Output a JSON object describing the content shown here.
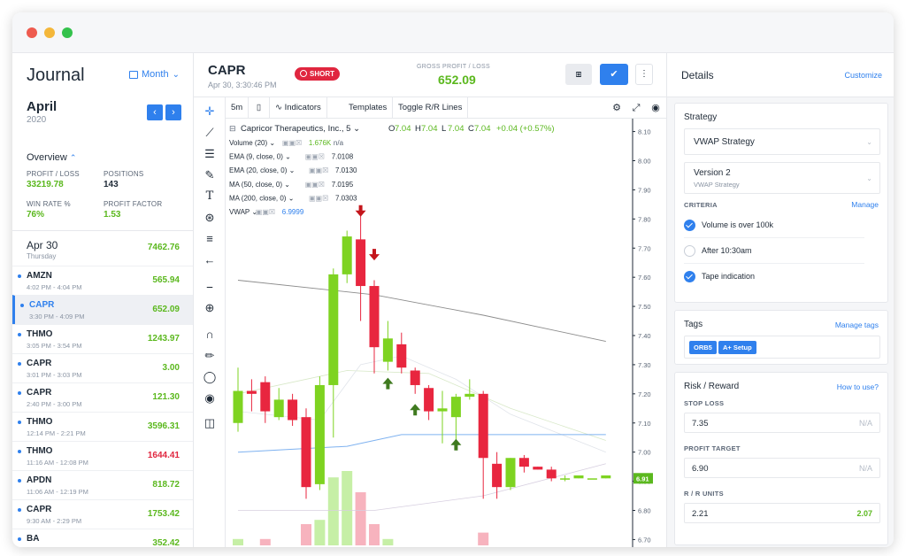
{
  "colors": {
    "accent": "#2f80ed",
    "green": "#5bb81e",
    "red": "#e0263f",
    "candle_up": "#7ed321",
    "candle_down": "#e8263f"
  },
  "journal": {
    "title": "Journal",
    "view_select": "Month",
    "month": "April",
    "year": "2020",
    "overview_label": "Overview",
    "stats": {
      "profit_loss_label": "PROFIT / LOSS",
      "profit_loss_value": "33219.78",
      "positions_label": "POSITIONS",
      "positions_value": "143",
      "win_rate_label": "WIN RATE %",
      "win_rate_value": "76%",
      "profit_factor_label": "PROFIT FACTOR",
      "profit_factor_value": "1.53"
    },
    "day": {
      "date": "Apr 30",
      "weekday": "Thursday",
      "total": "7462.76"
    },
    "trades": [
      {
        "symbol": "AMZN",
        "time": "4:02 PM - 4:04 PM",
        "value": "565.94",
        "color": "green",
        "active": false
      },
      {
        "symbol": "CAPR",
        "time": "3:30 PM - 4:09 PM",
        "value": "652.09",
        "color": "green",
        "active": true
      },
      {
        "symbol": "THMO",
        "time": "3:05 PM - 3:54 PM",
        "value": "1243.97",
        "color": "green",
        "active": false
      },
      {
        "symbol": "CAPR",
        "time": "3:01 PM - 3:03 PM",
        "value": "3.00",
        "color": "green",
        "active": false
      },
      {
        "symbol": "CAPR",
        "time": "2:40 PM - 3:00 PM",
        "value": "121.30",
        "color": "green",
        "active": false
      },
      {
        "symbol": "THMO",
        "time": "12:14 PM - 2:21 PM",
        "value": "3596.31",
        "color": "green",
        "active": false
      },
      {
        "symbol": "THMO",
        "time": "11:16 AM - 12:08 PM",
        "value": "1644.41",
        "color": "red",
        "active": false
      },
      {
        "symbol": "APDN",
        "time": "11:06 AM - 12:19 PM",
        "value": "818.72",
        "color": "green",
        "active": false
      },
      {
        "symbol": "CAPR",
        "time": "9:30 AM - 2:29 PM",
        "value": "1753.42",
        "color": "green",
        "active": false
      },
      {
        "symbol": "BA",
        "time": "",
        "value": "352.42",
        "color": "green",
        "active": false
      }
    ]
  },
  "center": {
    "symbol": "CAPR",
    "datetime": "Apr 30, 3:30:46 PM",
    "side_badge": "SHORT",
    "gross_label": "GROSS PROFIT / LOSS",
    "gross_value": "652.09",
    "toolbar": {
      "interval": "5m",
      "indicators": "Indicators",
      "templates": "Templates",
      "toggle": "Toggle R/R Lines"
    },
    "legend": {
      "instrument": "Capricor Therapeutics, Inc., 5",
      "open_label": "O",
      "open": "7.04",
      "high_label": "H",
      "high": "7.04",
      "low_label": "L",
      "low": "7.04",
      "close_label": "C",
      "close": "7.04",
      "change": "+0.04 (+0.57%)",
      "studies": [
        {
          "name": "Volume (20)",
          "value": "1.676K",
          "extra": "n/a",
          "color": "#5bb81e"
        },
        {
          "name": "EMA (9, close, 0)",
          "value": "7.0108",
          "extra": "",
          "color": "#1f2a37"
        },
        {
          "name": "EMA (20, close, 0)",
          "value": "7.0130",
          "extra": "",
          "color": "#1f2a37"
        },
        {
          "name": "MA (50, close, 0)",
          "value": "7.0195",
          "extra": "",
          "color": "#1f2a37"
        },
        {
          "name": "MA (200, close, 0)",
          "value": "7.0303",
          "extra": "",
          "color": "#1f2a37"
        },
        {
          "name": "VWAP",
          "value": "6.9999",
          "extra": "",
          "color": "#2f80ed"
        }
      ]
    },
    "price_tag": "6.91"
  },
  "chart_data": {
    "type": "candlestick",
    "y_ticks": [
      "8.10",
      "8.00",
      "7.90",
      "7.80",
      "7.70",
      "7.60",
      "7.50",
      "7.40",
      "7.30",
      "7.20",
      "7.10",
      "7.00",
      "6.90",
      "6.80",
      "6.70"
    ],
    "ylim": [
      6.68,
      8.12
    ],
    "candles": [
      {
        "o": 7.1,
        "c": 7.21,
        "h": 7.29,
        "l": 7.07,
        "v": 0.3
      },
      {
        "o": 7.21,
        "c": 7.2,
        "h": 7.25,
        "l": 7.14,
        "v": 0.0
      },
      {
        "o": 7.24,
        "c": 7.14,
        "h": 7.26,
        "l": 7.1,
        "v": 0.3
      },
      {
        "o": 7.12,
        "c": 7.18,
        "h": 7.22,
        "l": 7.11,
        "v": 0.0
      },
      {
        "o": 7.18,
        "c": 7.11,
        "h": 7.2,
        "l": 7.09,
        "v": 0.0
      },
      {
        "o": 7.12,
        "c": 6.88,
        "h": 7.15,
        "l": 6.84,
        "v": 1.0
      },
      {
        "o": 6.89,
        "c": 7.23,
        "h": 7.26,
        "l": 6.87,
        "v": 1.2
      },
      {
        "o": 7.23,
        "c": 7.61,
        "h": 7.63,
        "l": 7.05,
        "v": 3.2
      },
      {
        "o": 7.61,
        "c": 7.74,
        "h": 7.76,
        "l": 7.58,
        "v": 3.5
      },
      {
        "o": 7.73,
        "c": 7.57,
        "h": 7.83,
        "l": 7.45,
        "v": 2.5
      },
      {
        "o": 7.57,
        "c": 7.36,
        "h": 7.59,
        "l": 7.27,
        "v": 1.0
      },
      {
        "o": 7.31,
        "c": 7.39,
        "h": 7.45,
        "l": 7.28,
        "v": 0.3
      },
      {
        "o": 7.37,
        "c": 7.29,
        "h": 7.41,
        "l": 7.27,
        "v": 0.0
      },
      {
        "o": 7.28,
        "c": 7.23,
        "h": 7.29,
        "l": 7.2,
        "v": 0.0
      },
      {
        "o": 7.22,
        "c": 7.14,
        "h": 7.23,
        "l": 7.11,
        "v": 0.0
      },
      {
        "o": 7.14,
        "c": 7.15,
        "h": 7.21,
        "l": 7.03,
        "v": 0.0
      },
      {
        "o": 7.12,
        "c": 7.19,
        "h": 7.2,
        "l": 7.01,
        "v": 0.0
      },
      {
        "o": 7.19,
        "c": 7.2,
        "h": 7.25,
        "l": 7.18,
        "v": 0.0
      },
      {
        "o": 7.2,
        "c": 6.98,
        "h": 7.21,
        "l": 6.84,
        "v": 0.6
      },
      {
        "o": 6.96,
        "c": 6.88,
        "h": 7.0,
        "l": 6.84,
        "v": 0.0
      },
      {
        "o": 6.88,
        "c": 6.98,
        "h": 6.98,
        "l": 6.87,
        "v": 0.0
      },
      {
        "o": 6.98,
        "c": 6.95,
        "h": 6.99,
        "l": 6.93,
        "v": 0.0
      },
      {
        "o": 6.95,
        "c": 6.94,
        "h": 6.95,
        "l": 6.94,
        "v": 0.0
      },
      {
        "o": 6.94,
        "c": 6.91,
        "h": 6.95,
        "l": 6.9,
        "v": 0.0
      },
      {
        "o": 6.91,
        "c": 6.91,
        "h": 6.92,
        "l": 6.9,
        "v": 0.0
      },
      {
        "o": 6.91,
        "c": 6.92,
        "h": 6.92,
        "l": 6.91,
        "v": 0.0
      },
      {
        "o": 6.91,
        "c": 6.91,
        "h": 6.91,
        "l": 6.91,
        "v": 0.0
      },
      {
        "o": 6.91,
        "c": 6.92,
        "h": 6.92,
        "l": 6.91,
        "v": 0.0
      }
    ],
    "vwap_line": [
      [
        0,
        7.0
      ],
      [
        8,
        7.02
      ],
      [
        12,
        7.06
      ],
      [
        16,
        7.06
      ],
      [
        27,
        7.06
      ]
    ],
    "ma200_line": [
      [
        0,
        7.59
      ],
      [
        10,
        7.54
      ],
      [
        18,
        7.47
      ],
      [
        27,
        7.38
      ]
    ],
    "ema_fast_line": [
      [
        0,
        7.14
      ],
      [
        6,
        7.11
      ],
      [
        9,
        7.3
      ],
      [
        12,
        7.33
      ],
      [
        16,
        7.25
      ],
      [
        20,
        7.13
      ],
      [
        27,
        7.0
      ]
    ],
    "ema_slow_line": [
      [
        0,
        7.2
      ],
      [
        8,
        7.28
      ],
      [
        14,
        7.27
      ],
      [
        20,
        7.15
      ],
      [
        27,
        7.04
      ]
    ],
    "ma50_line": [
      [
        0,
        6.8
      ],
      [
        10,
        6.8
      ],
      [
        18,
        6.85
      ],
      [
        27,
        6.96
      ]
    ],
    "sell_arrows": [
      {
        "i": 9,
        "price": 7.82
      },
      {
        "i": 10,
        "price": 7.67
      }
    ],
    "buy_arrows": [
      {
        "i": 11,
        "price": 7.24
      },
      {
        "i": 13,
        "price": 7.15
      },
      {
        "i": 16,
        "price": 7.03
      }
    ]
  },
  "details": {
    "title": "Details",
    "customize": "Customize",
    "strategy_label": "Strategy",
    "strategy_value": "VWAP Strategy",
    "version_title": "Version 2",
    "version_sub": "VWAP Strategy",
    "criteria_label": "CRITERIA",
    "criteria_manage": "Manage",
    "criteria": [
      {
        "text": "Volume is over 100k",
        "checked": true
      },
      {
        "text": "After 10:30am",
        "checked": false
      },
      {
        "text": "Tape indication",
        "checked": true
      }
    ],
    "tags_label": "Tags",
    "tags_manage": "Manage tags",
    "tags": [
      "ORB5",
      "A+ Setup"
    ],
    "rr_label": "Risk / Reward",
    "rr_help": "How to use?",
    "stop_loss_label": "STOP LOSS",
    "stop_loss_value": "7.35",
    "stop_loss_right": "N/A",
    "profit_target_label": "PROFIT TARGET",
    "profit_target_value": "6.90",
    "profit_target_right": "N/A",
    "rr_units_label": "R / R UNITS",
    "rr_units_value": "2.21",
    "rr_units_right": "2.07"
  }
}
